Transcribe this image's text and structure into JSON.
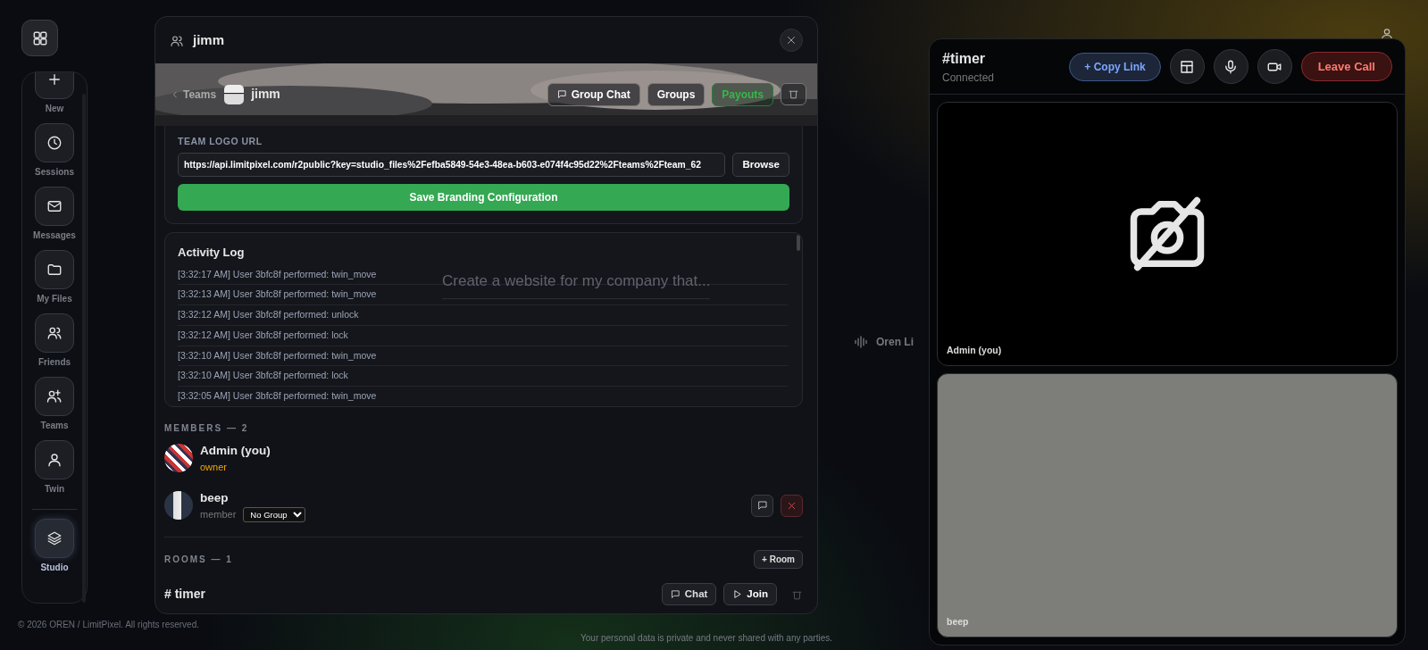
{
  "background": {
    "prompt": "Create a website for my company that...",
    "voice_label": "Oren Li",
    "copyright": "© 2026 OREN / LimitPixel. All rights reserved.",
    "privacy": "Your personal data is private and never shared with any parties."
  },
  "sidebar": {
    "items": [
      {
        "label": "New",
        "selected": false
      },
      {
        "label": "Sessions",
        "selected": false
      },
      {
        "label": "Messages",
        "selected": false
      },
      {
        "label": "My Files",
        "selected": false
      },
      {
        "label": "Friends",
        "selected": false
      },
      {
        "label": "Teams",
        "selected": false
      },
      {
        "label": "Twin",
        "selected": false
      },
      {
        "label": "Studio",
        "selected": true
      }
    ]
  },
  "team_modal": {
    "title": "jimm",
    "banner": {
      "back": "Teams",
      "team_name": "jimm",
      "buttons": [
        {
          "label": "Group Chat",
          "kind": "chat"
        },
        {
          "label": "Groups",
          "kind": "plain"
        },
        {
          "label": "Payouts",
          "kind": "success"
        }
      ]
    },
    "branding": {
      "label": "TEAM LOGO URL",
      "value": "https://api.limitpixel.com/r2public?key=studio_files%2Fefba5849-54e3-48ea-b603-e074f4c95d22%2Fteams%2Fteam_62",
      "browse": "Browse",
      "save": "Save Branding Configuration"
    },
    "activity": {
      "title": "Activity Log",
      "entries": [
        "[3:32:17 AM] User 3bfc8f performed: twin_move",
        "[3:32:13 AM] User 3bfc8f performed: twin_move",
        "[3:32:12 AM] User 3bfc8f performed: unlock",
        "[3:32:12 AM] User 3bfc8f performed: lock",
        "[3:32:10 AM] User 3bfc8f performed: twin_move",
        "[3:32:10 AM] User 3bfc8f performed: lock",
        "[3:32:05 AM] User 3bfc8f performed: twin_move"
      ]
    },
    "members": {
      "heading": "MEMBERS — 2",
      "list": [
        {
          "name": "Admin (you)",
          "role": "owner",
          "kind": "owner"
        },
        {
          "name": "beep",
          "role": "member",
          "group": "No Group",
          "kind": "member"
        }
      ]
    },
    "rooms": {
      "heading": "ROOMS — 1",
      "add": "+ Room",
      "list": [
        {
          "name": "# timer",
          "chat": "Chat",
          "join": "Join"
        }
      ]
    }
  },
  "call": {
    "title": "#timer",
    "status": "Connected",
    "copy_link": "+ Copy Link",
    "leave": "Leave Call",
    "tiles": [
      {
        "name": "Admin (you)",
        "camera_off": true
      },
      {
        "name": "beep",
        "camera_off": false
      }
    ]
  }
}
